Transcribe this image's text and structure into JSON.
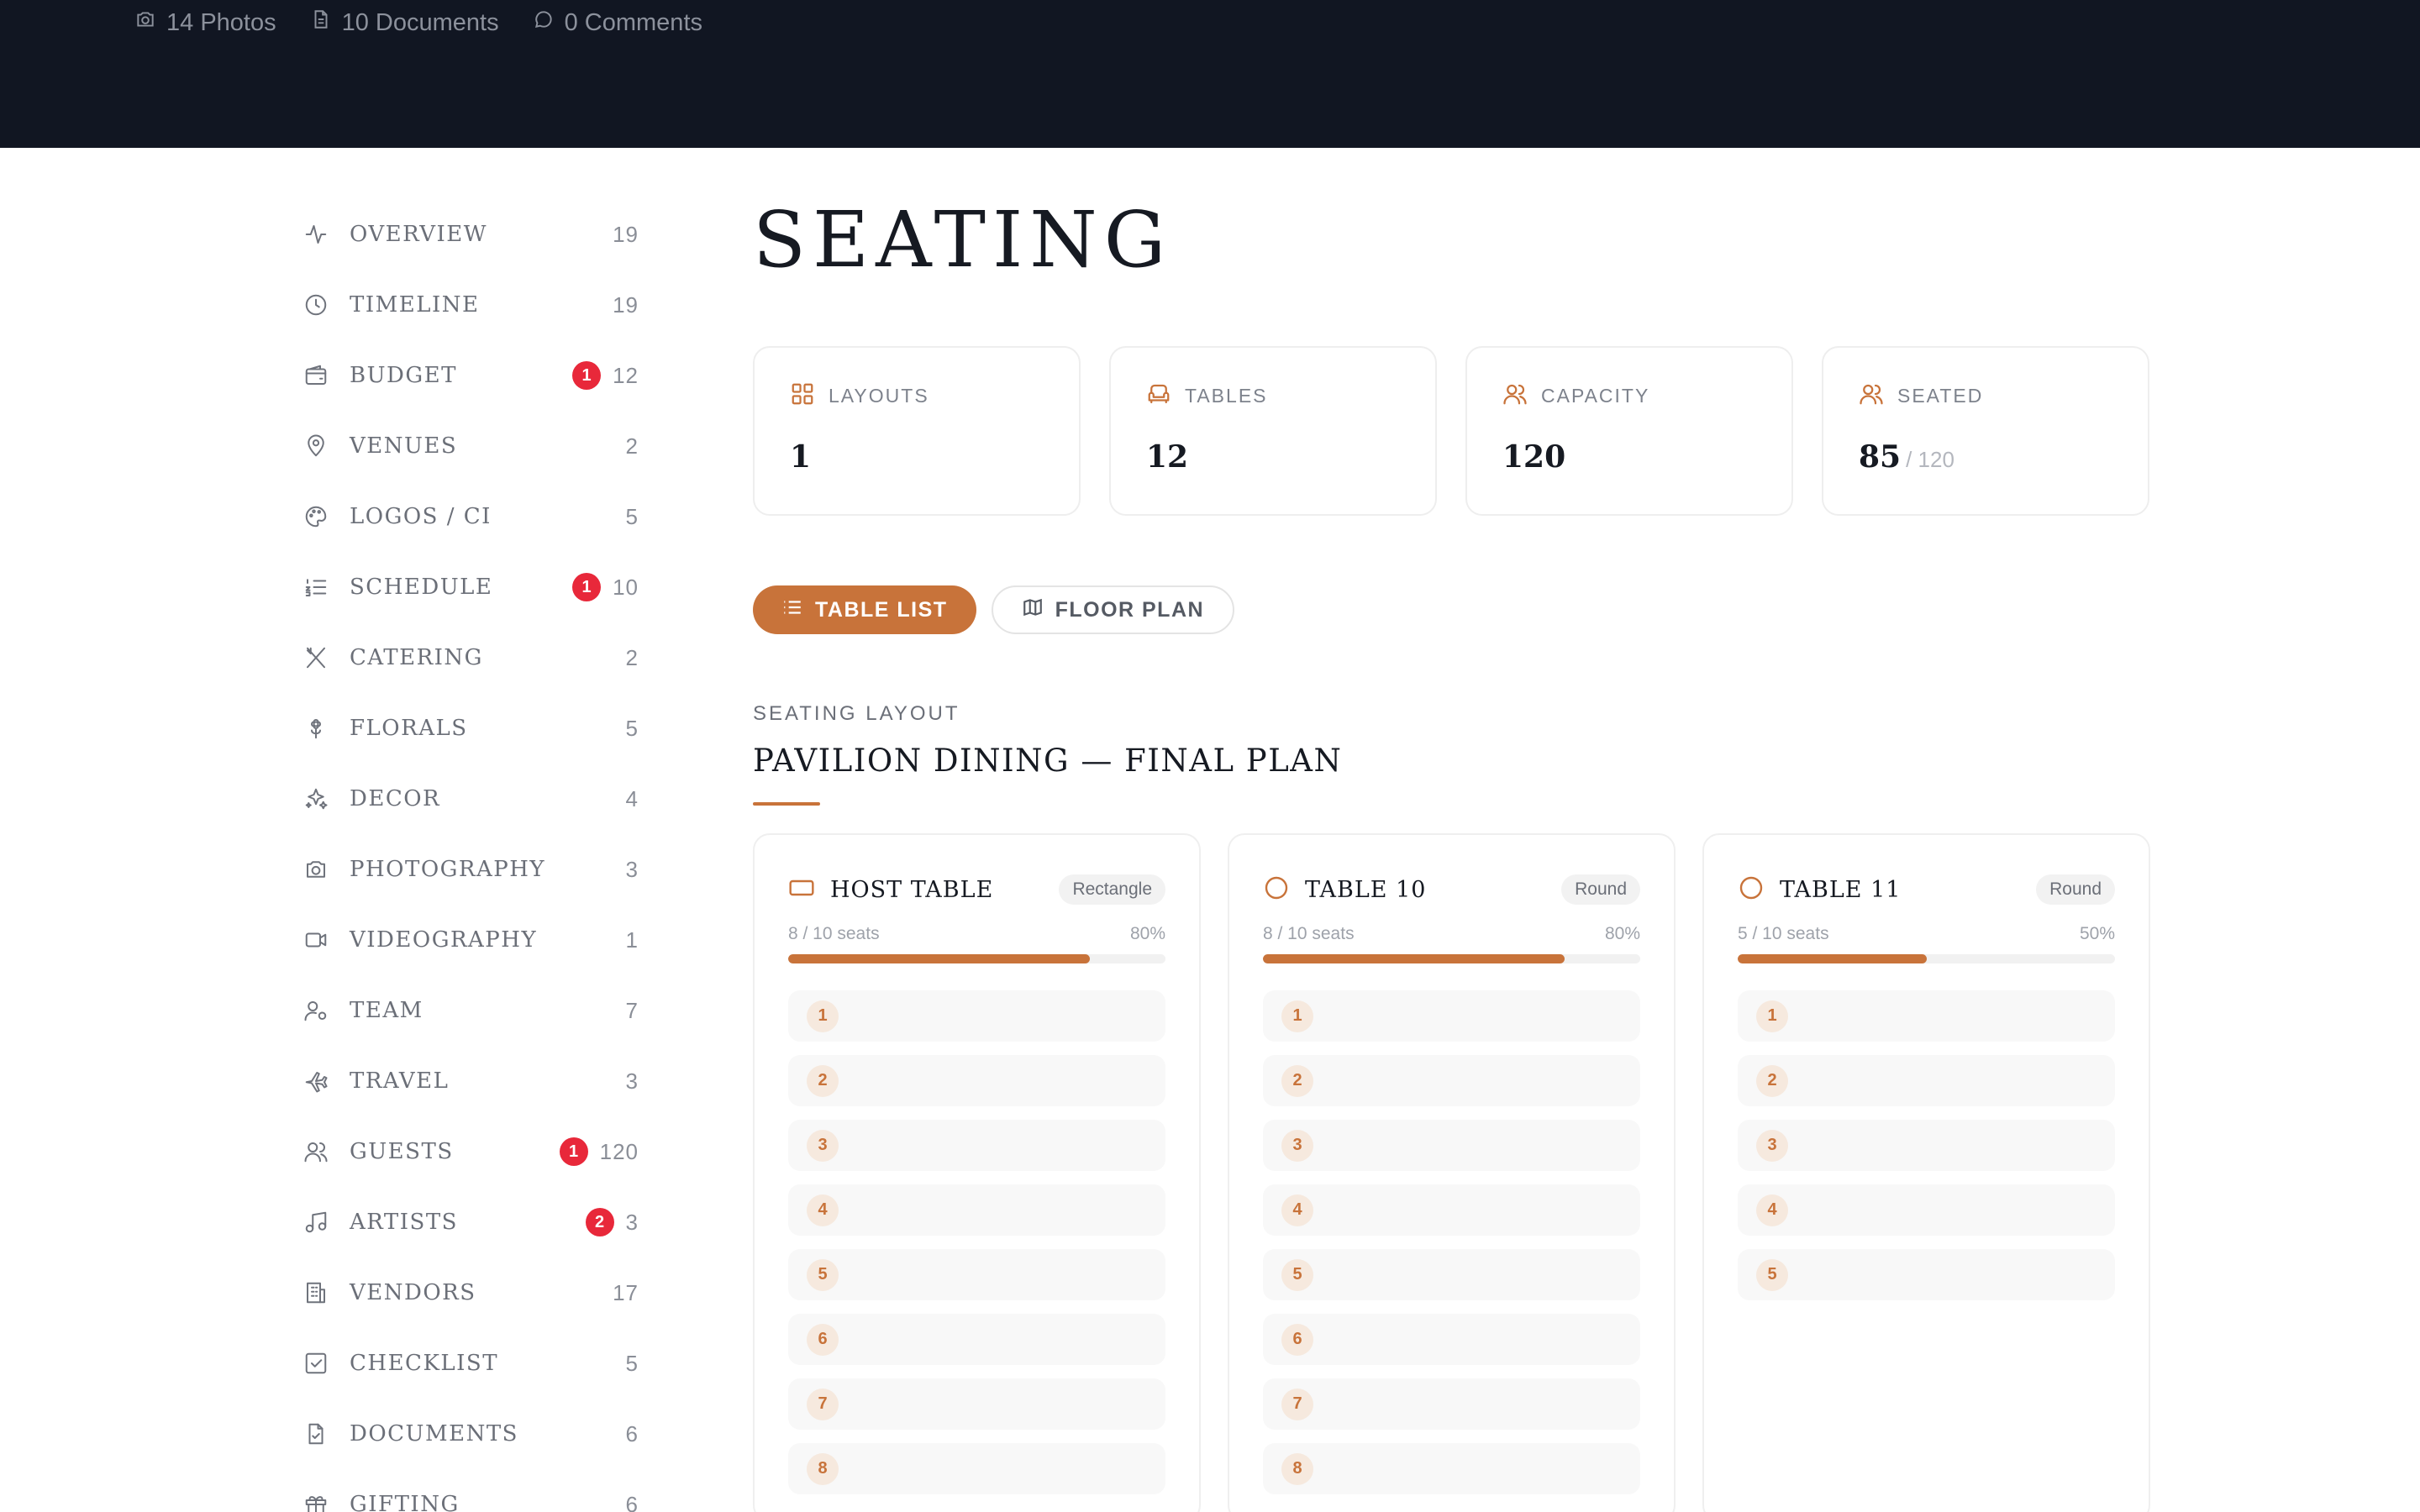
{
  "header": {
    "stats": [
      {
        "icon": "camera-icon",
        "label": "14 Photos"
      },
      {
        "icon": "document-icon",
        "label": "10 Documents"
      },
      {
        "icon": "comment-icon",
        "label": "0 Comments"
      }
    ]
  },
  "sidebar": {
    "items": [
      {
        "label": "OVERVIEW",
        "count": "19",
        "badge": "",
        "icon": "activity-icon"
      },
      {
        "label": "TIMELINE",
        "count": "19",
        "badge": "",
        "icon": "clock-icon"
      },
      {
        "label": "BUDGET",
        "count": "12",
        "badge": "1",
        "icon": "wallet-icon"
      },
      {
        "label": "VENUES",
        "count": "2",
        "badge": "",
        "icon": "map-pin-icon"
      },
      {
        "label": "LOGOS / CI",
        "count": "5",
        "badge": "",
        "icon": "palette-icon"
      },
      {
        "label": "SCHEDULE",
        "count": "10",
        "badge": "1",
        "icon": "list-ordered-icon"
      },
      {
        "label": "CATERING",
        "count": "2",
        "badge": "",
        "icon": "utensils-icon"
      },
      {
        "label": "FLORALS",
        "count": "5",
        "badge": "",
        "icon": "flower-icon"
      },
      {
        "label": "DECOR",
        "count": "4",
        "badge": "",
        "icon": "sparkles-icon"
      },
      {
        "label": "PHOTOGRAPHY",
        "count": "3",
        "badge": "",
        "icon": "camera-icon"
      },
      {
        "label": "VIDEOGRAPHY",
        "count": "1",
        "badge": "",
        "icon": "video-icon"
      },
      {
        "label": "TEAM",
        "count": "7",
        "badge": "",
        "icon": "user-cog-icon"
      },
      {
        "label": "TRAVEL",
        "count": "3",
        "badge": "",
        "icon": "plane-icon"
      },
      {
        "label": "GUESTS",
        "count": "120",
        "badge": "1",
        "icon": "users-icon"
      },
      {
        "label": "ARTISTS",
        "count": "3",
        "badge": "2",
        "icon": "music-icon"
      },
      {
        "label": "VENDORS",
        "count": "17",
        "badge": "",
        "icon": "building-icon"
      },
      {
        "label": "CHECKLIST",
        "count": "5",
        "badge": "",
        "icon": "check-square-icon"
      },
      {
        "label": "DOCUMENTS",
        "count": "6",
        "badge": "",
        "icon": "file-check-icon"
      },
      {
        "label": "GIFTING",
        "count": "6",
        "badge": "",
        "icon": "gift-icon"
      }
    ]
  },
  "main": {
    "title": "SEATING",
    "kpis": [
      {
        "label": "LAYOUTS",
        "value": "1",
        "sub": "",
        "icon": "layout-grid-icon"
      },
      {
        "label": "TABLES",
        "value": "12",
        "sub": "",
        "icon": "armchair-icon"
      },
      {
        "label": "CAPACITY",
        "value": "120",
        "sub": "",
        "icon": "users-icon"
      },
      {
        "label": "SEATED",
        "value": "85",
        "sub": "/ 120",
        "icon": "users-icon"
      }
    ],
    "views": [
      {
        "label": "TABLE LIST",
        "icon": "list-icon",
        "active": true
      },
      {
        "label": "FLOOR PLAN",
        "icon": "map-icon",
        "active": false
      }
    ],
    "layout_eyebrow": "SEATING LAYOUT",
    "layout_title": "PAVILION DINING — FINAL PLAN",
    "tables": [
      {
        "name": "HOST TABLE",
        "shape": "Rectangle",
        "shape_icon": "rectangle-icon",
        "seats_text": "8 / 10 seats",
        "percent_text": "80%",
        "fill": 0.8,
        "seats": [
          "1",
          "2",
          "3",
          "4",
          "5",
          "6",
          "7",
          "8"
        ]
      },
      {
        "name": "TABLE 10",
        "shape": "Round",
        "shape_icon": "circle-icon",
        "seats_text": "8 / 10 seats",
        "percent_text": "80%",
        "fill": 0.8,
        "seats": [
          "1",
          "2",
          "3",
          "4",
          "5",
          "6",
          "7",
          "8"
        ]
      },
      {
        "name": "TABLE 11",
        "shape": "Round",
        "shape_icon": "circle-icon",
        "seats_text": "5 / 10 seats",
        "percent_text": "50%",
        "fill": 0.5,
        "seats": [
          "1",
          "2",
          "3",
          "4",
          "5"
        ]
      }
    ]
  },
  "colors": {
    "accent": "#c8733a",
    "header_bg": "#111622",
    "badge": "#e8283a"
  }
}
